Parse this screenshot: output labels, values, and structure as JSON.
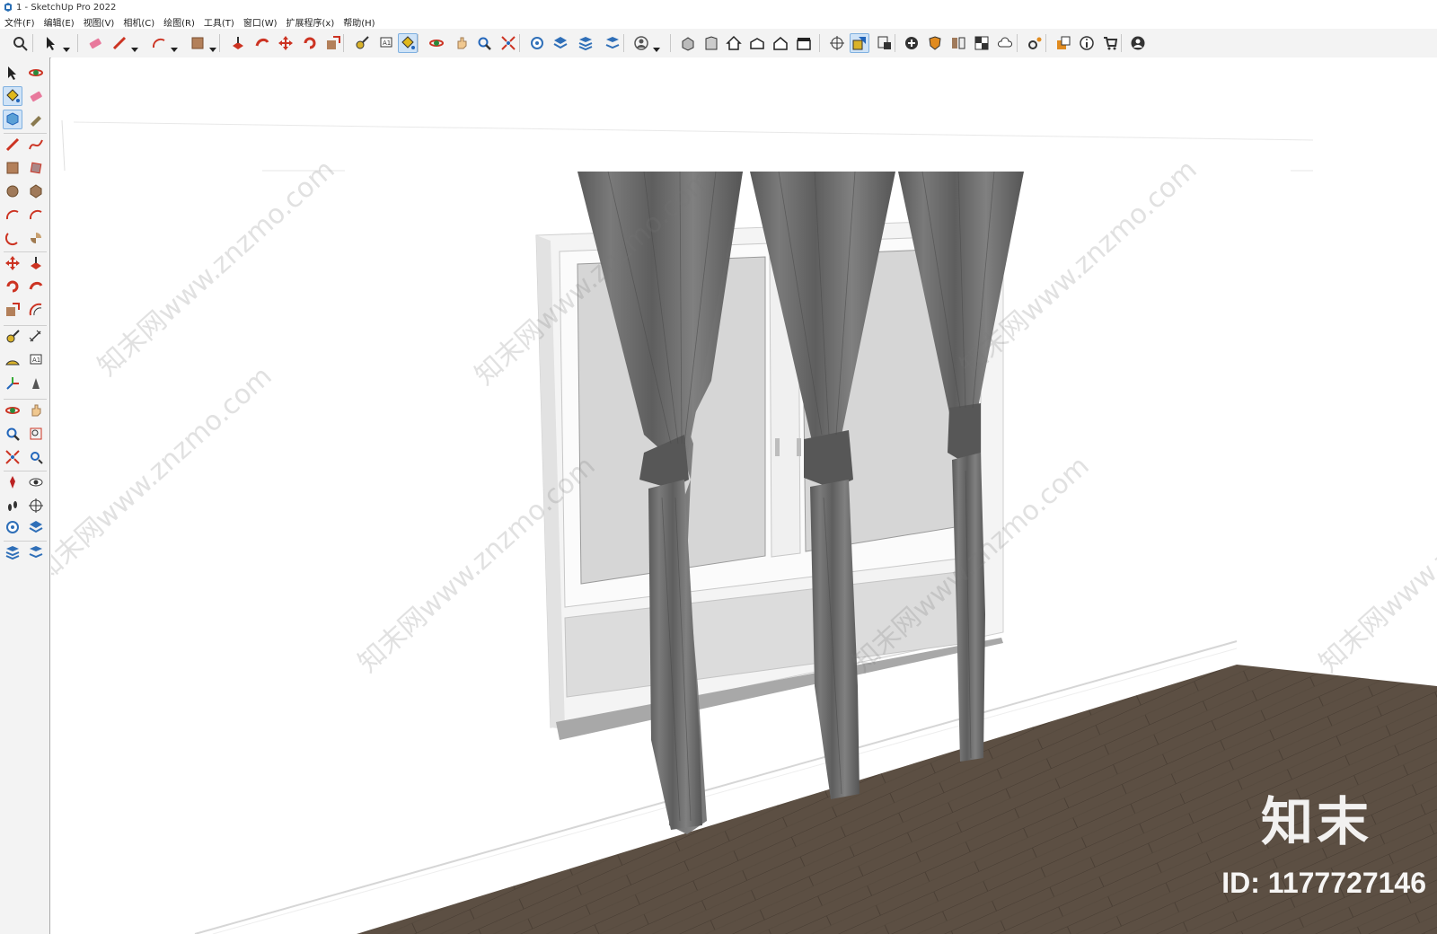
{
  "window": {
    "title": "1 - SketchUp Pro 2022"
  },
  "menu": [
    "文件(F)",
    "编辑(E)",
    "视图(V)",
    "相机(C)",
    "绘图(R)",
    "工具(T)",
    "窗口(W)",
    "扩展程序(x)",
    "帮助(H)"
  ],
  "toolbar": {
    "items": [
      "search-icon",
      "select-icon",
      "eraser-icon",
      "pencil-icon",
      "arc-icon",
      "rectangle-icon",
      "push-pull-icon",
      "follow-me-icon",
      "move-icon",
      "rotate-icon",
      "scale-icon",
      "tape-measure-icon",
      "text-icon",
      "paint-bucket-icon",
      "orbit-icon",
      "pan-icon",
      "zoom-icon",
      "zoom-extents-icon",
      "warehouse-icon",
      "extensions-icon",
      "layout-icon",
      "send-icon",
      "profile-icon",
      "iso-view-icon",
      "front-view-icon",
      "home-icon",
      "top-view-icon",
      "right-view-icon",
      "back-view-icon",
      "section-plane-icon",
      "section-display-icon",
      "section-cut-icon",
      "add-icon",
      "shield-icon",
      "styles-icon",
      "checker-icon",
      "cloud-icon",
      "settings-icon",
      "scenes-icon",
      "info-icon",
      "cart-icon",
      "account-icon"
    ]
  },
  "left_toolbar": {
    "items": [
      "select-icon",
      "orbit-icon",
      "paint-bucket-icon",
      "eraser-icon",
      "component-icon",
      "tag-icon",
      "pencil-icon",
      "freehand-icon",
      "rectangle-icon",
      "rotated-rectangle-icon",
      "circle-icon",
      "polygon-icon",
      "arc-icon",
      "two-point-arc-icon",
      "three-point-arc-icon",
      "pie-icon",
      "move-icon",
      "push-pull-icon",
      "rotate-icon",
      "follow-me-icon",
      "scale-icon",
      "offset-icon",
      "tape-measure-icon",
      "dimension-icon",
      "protractor-icon",
      "text-icon",
      "axes-icon",
      "3d-text-icon",
      "orbit-icon",
      "pan-icon",
      "zoom-icon",
      "zoom-window-icon",
      "zoom-extents-icon",
      "previous-view-icon",
      "position-camera-icon",
      "look-around-icon",
      "walk-icon",
      "section-plane-icon",
      "warehouse-icon",
      "extension-warehouse-icon",
      "layout-icon",
      "send-layout-icon"
    ]
  },
  "watermarks": [
    "知末网www.znzmo.com",
    "知末网www.znzmo.com",
    "知末网www.znzmo.com",
    "知末网www.znzmo.com",
    "知末网www.znzmo.com",
    "知末网www.znzmo.com",
    "知末网www.znzmo.com"
  ],
  "brand": {
    "logo": "知末",
    "id": "ID: 1177727146"
  },
  "colors": {
    "curtain": "#6e6e6e",
    "floor": "#5c4f43",
    "glass": "#d9d9d9",
    "frame": "#f2f2f2",
    "active_tool": "#cfe3f7"
  }
}
